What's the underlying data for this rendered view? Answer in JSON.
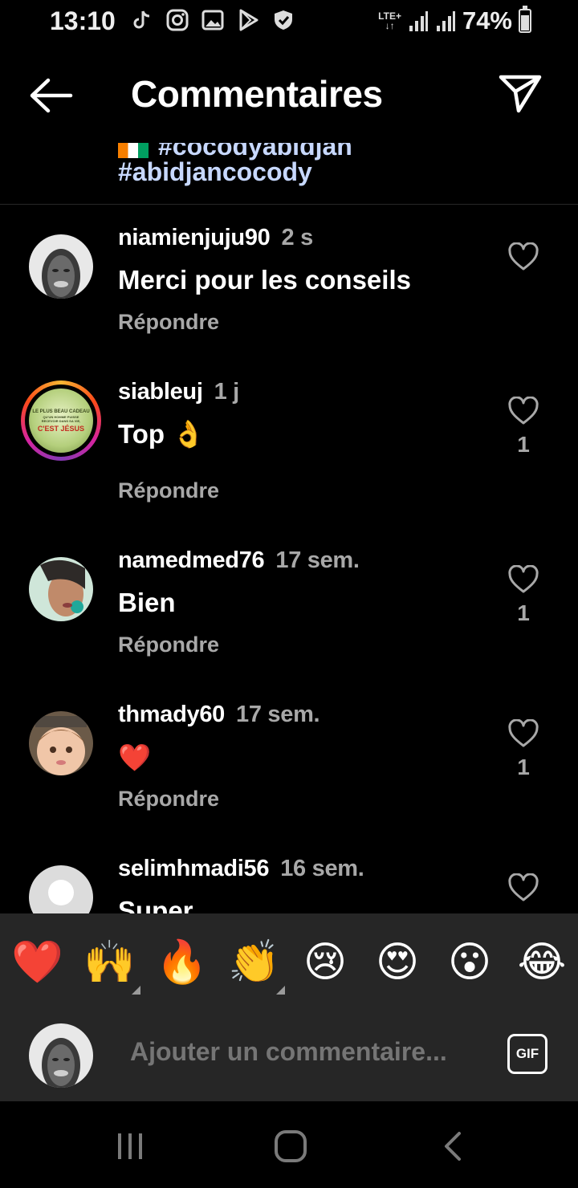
{
  "status_bar": {
    "time": "13:10",
    "network": "LTE+",
    "battery": "74%",
    "battery_level": 0.74,
    "icons": [
      "tiktok-icon",
      "instagram-icon",
      "gallery-icon",
      "play-store-icon",
      "shield-icon",
      "signal-icon",
      "signal-icon",
      "battery-icon"
    ]
  },
  "header": {
    "title": "Commentaires",
    "back_icon": "arrow-left-icon",
    "send_icon": "paper-plane-icon"
  },
  "caption": {
    "partial_line": "#cocodyabidjan",
    "hashtag": "#abidjancocody"
  },
  "comments": [
    {
      "username": "niamienjuju90",
      "time": "2 s",
      "text": "Merci pour les conseils",
      "reply": "Répondre",
      "likes": ""
    },
    {
      "username": "siableuj",
      "time": "1 j",
      "text": "Top 👌",
      "reply": "Répondre",
      "likes": "1",
      "avatar_text": {
        "line1": "LE PLUS BEAU CADEAU",
        "line2": "QU'UN HOMME PUISSE RECEVOIR DANS SA VIE,",
        "line3": "C'EST JÉSUS"
      }
    },
    {
      "username": "namedmed76",
      "time": "17 sem.",
      "text": "Bien",
      "reply": "Répondre",
      "likes": "1"
    },
    {
      "username": "thmady60",
      "time": "17 sem.",
      "text": "❤️",
      "reply": "Répondre",
      "likes": "1"
    },
    {
      "username": "selimhmadi56",
      "time": "16 sem.",
      "text": "Super",
      "reply": "",
      "likes": ""
    }
  ],
  "emoji_bar": [
    "❤️",
    "🙌",
    "🔥",
    "👏",
    "😢",
    "😍",
    "😮",
    "😂"
  ],
  "input": {
    "placeholder": "Ajouter un commentaire...",
    "gif_label": "GIF"
  },
  "colors": {
    "background": "#000000",
    "panel": "#262626",
    "secondary_text": "#a8a8a8",
    "hashtag": "#c7d8ff"
  }
}
